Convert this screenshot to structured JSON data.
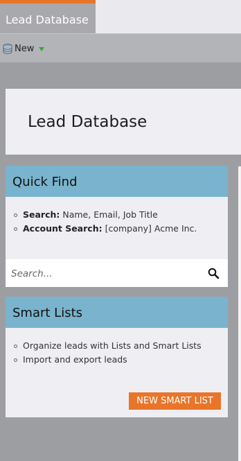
{
  "topbar": {
    "active_tab": "Lead Database"
  },
  "toolbar": {
    "new_label": "New",
    "new_icon": "database-icon",
    "menu_icon": "chevron-down-icon"
  },
  "header": {
    "title": "Lead Database"
  },
  "quick_find": {
    "title": "Quick Find",
    "items": [
      {
        "label": "Search:",
        "text": " Name, Email, Job Title"
      },
      {
        "label": "Account Search:",
        "text": " [company] Acme Inc."
      }
    ],
    "search_placeholder": "Search...",
    "search_icon": "search-icon"
  },
  "smart_lists": {
    "title": "Smart Lists",
    "items": [
      "Organize leads with Lists and Smart Lists",
      "Import and export leads"
    ],
    "button_label": "NEW SMART LIST"
  },
  "colors": {
    "accent": "#e8752a",
    "panel_header": "#7ab3cd",
    "background": "#9d9ea2",
    "panel": "#eeeef3"
  }
}
